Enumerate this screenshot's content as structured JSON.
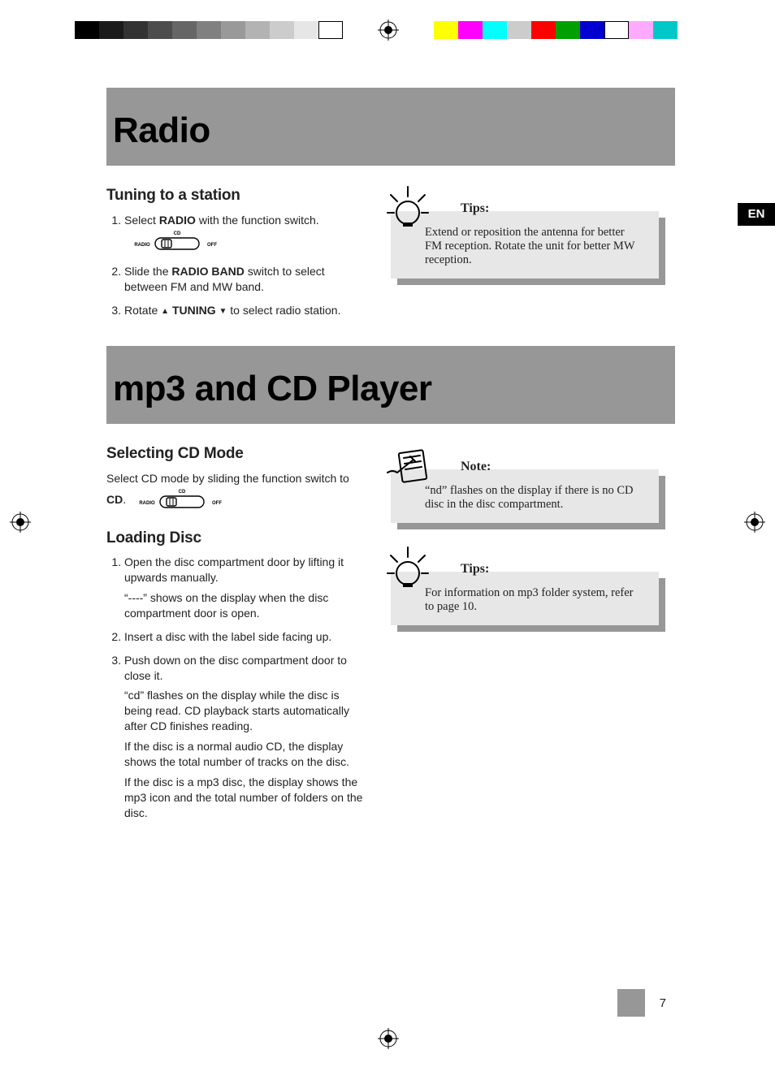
{
  "print": {
    "grayscale": [
      "#000000",
      "#1a1a1a",
      "#333333",
      "#4d4d4d",
      "#666666",
      "#808080",
      "#999999",
      "#b3b3b3",
      "#cccccc",
      "#e6e6e6",
      "#ffffff"
    ],
    "process": [
      "#ffff00",
      "#ff00ff",
      "#00ffff",
      "#cccccc",
      "#ff0000",
      "#00a000",
      "#0000d0",
      "#ffffff",
      "#ffaaff",
      "#00c8c8"
    ]
  },
  "lang_tab": "EN",
  "page_number": "7",
  "section1": {
    "title": "Radio",
    "sub": "Tuning to a station",
    "switch": {
      "left": "RADIO",
      "top": "CD",
      "right": "OFF"
    },
    "step1_a": "Select ",
    "step1_b": "RADIO",
    "step1_c": " with the function switch.",
    "step2_a": "Slide the ",
    "step2_b": "RADIO BAND",
    "step2_c": " switch to select between FM and MW band.",
    "step3_a": "Rotate  ",
    "step3_b": "TUNING",
    "step3_c": "  to select radio station.",
    "tip_title": "Tips:",
    "tip_body": "Extend or reposition the antenna for better FM reception. Rotate the unit for better MW reception."
  },
  "section2": {
    "title": "mp3 and CD Player",
    "sub1": "Selecting CD Mode",
    "body1_a": "Select CD mode by sliding the function switch to ",
    "body1_b": "CD",
    "body1_c": ".",
    "switch": {
      "left": "RADIO",
      "top": "CD",
      "right": "OFF"
    },
    "sub2": "Loading Disc",
    "step1": "Open the disc compartment door by lifting it upwards manually.",
    "step1_p": "“----” shows on the display when the disc compartment door is open.",
    "step2": "Insert a disc with the label side facing up.",
    "step3": "Push down on the disc compartment door to close it.",
    "step3_p1": "“cd” flashes on the display while the disc is being read. CD playback starts automatically after CD finishes reading.",
    "step3_p2": "If the disc is a normal audio CD, the display shows the total number of tracks on the disc.",
    "step3_p3": "If the disc is a mp3 disc, the display shows the mp3 icon and the total number of folders on the disc.",
    "note_title": "Note:",
    "note_body": "“nd” flashes on the display if there is no CD disc in the disc compartment.",
    "tip_title": "Tips:",
    "tip_body": "For information on mp3 folder system, refer to page 10."
  }
}
